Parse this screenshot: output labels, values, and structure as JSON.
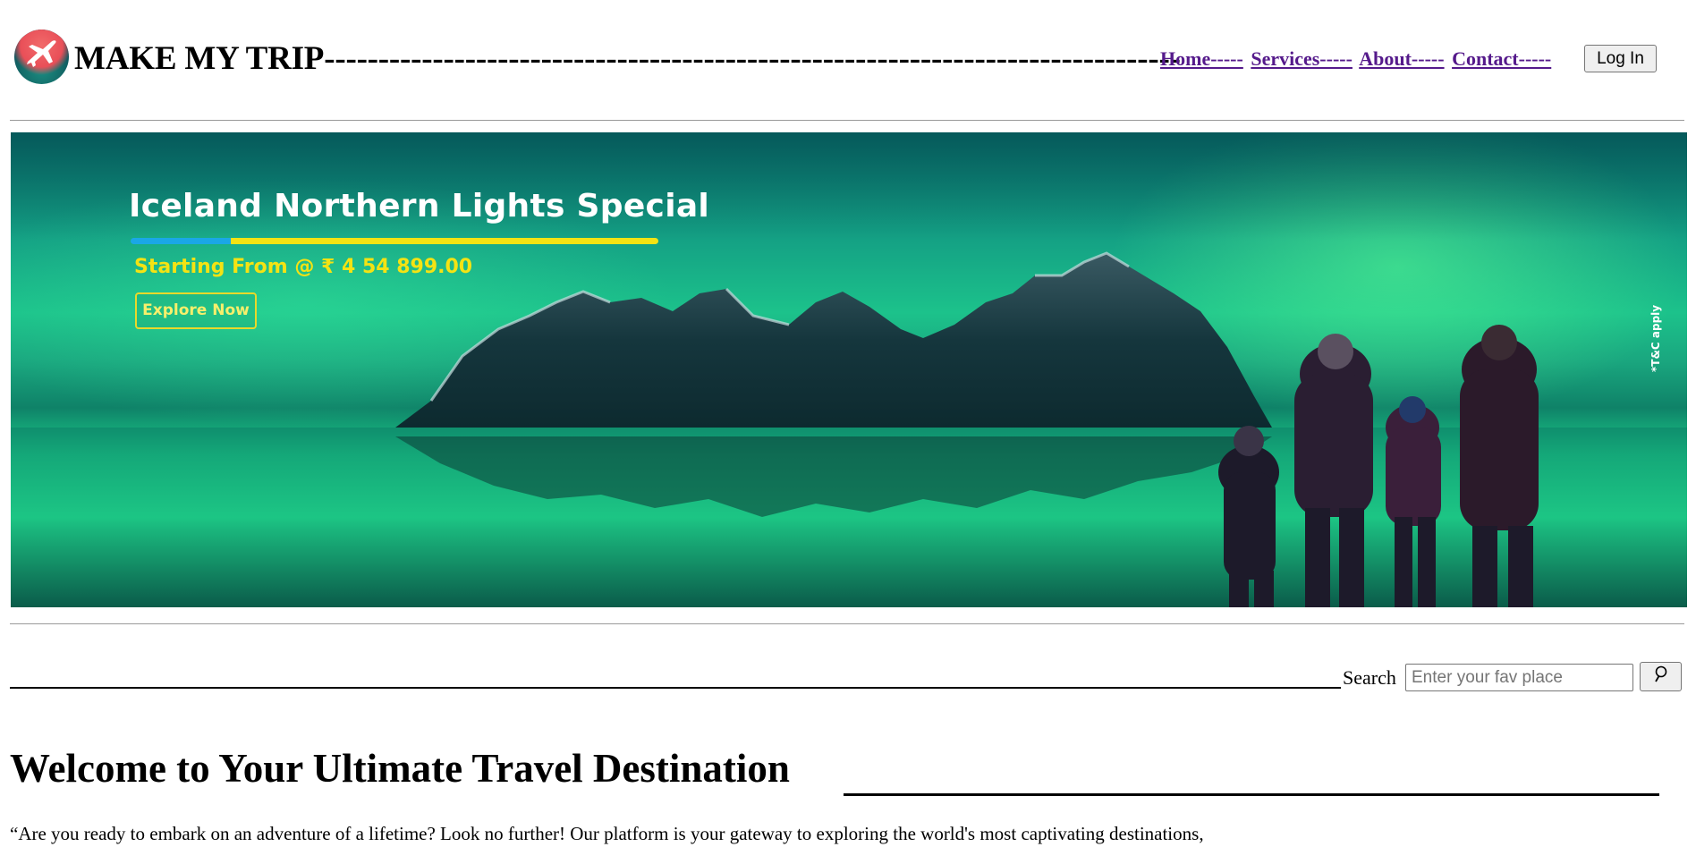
{
  "header": {
    "logo_icon": "airplane-globe-icon",
    "brand": "MAKE MY TRIP-------------------------------------------------------------------------------",
    "nav": [
      {
        "label": "Home-----"
      },
      {
        "label": "Services-----"
      },
      {
        "label": "About-----"
      },
      {
        "label": "Contact-----"
      }
    ],
    "login_label": "Log In"
  },
  "banner": {
    "title": "Iceland Northern Lights Special",
    "price": "Starting From @ ₹ 4 54 899.00",
    "cta": "Explore Now",
    "terms": "*T&C apply",
    "colors": {
      "title": "#ffffff",
      "accent_yellow": "#f4e313",
      "accent_blue": "#1aa7e6"
    }
  },
  "search": {
    "label": "Search",
    "placeholder": "Enter your fav place",
    "value": "",
    "button_icon": "search-icon"
  },
  "main": {
    "heading": "Welcome to Your Ultimate Travel Destination",
    "intro": "“Are you ready to embark on an adventure of a lifetime? Look no further! Our platform is your gateway to exploring the world's most captivating destinations,"
  }
}
